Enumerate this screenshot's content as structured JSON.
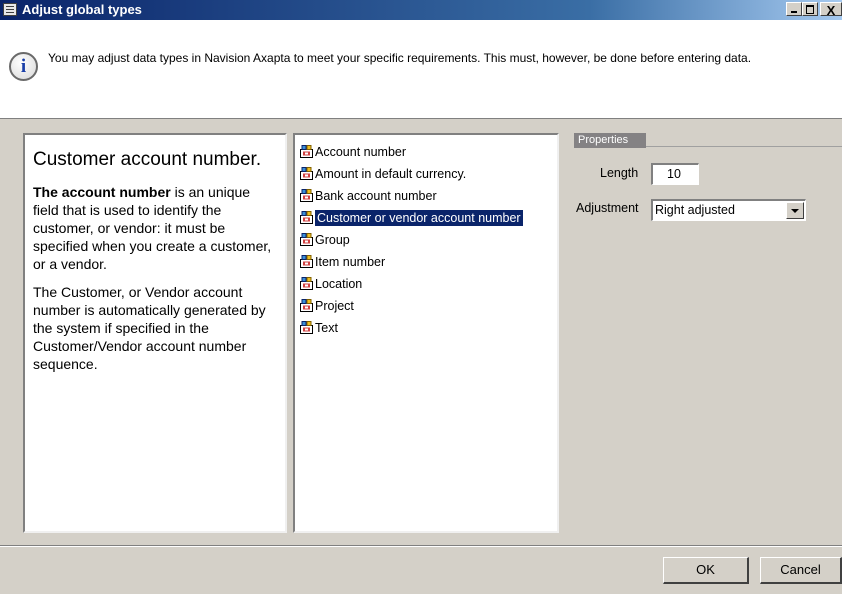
{
  "window": {
    "title": "Adjust global types",
    "close_glyph": "X"
  },
  "info": {
    "icon": "info-icon",
    "icon_glyph": "i",
    "text": "You may adjust data types in Navision Axapta to meet your specific requirements. This must, however, be done before entering data."
  },
  "help": {
    "title": "Customer account number.",
    "p1_bold": "The account number",
    "p1_rest": " is an unique field that is used to identify the customer, or vendor: it must be specified when you create a customer, or a vendor.",
    "p2": "The Customer, or Vendor account number is automatically generated by the system if specified in the Customer/Vendor account number sequence."
  },
  "types": {
    "items": [
      {
        "label": "Account number",
        "icon": "extended-datatype-icon"
      },
      {
        "label": "Amount in default currency.",
        "icon": "extended-datatype-icon"
      },
      {
        "label": "Bank account number",
        "icon": "extended-datatype-icon"
      },
      {
        "label": "Customer or vendor account number",
        "icon": "extended-datatype-icon",
        "selected": true
      },
      {
        "label": "Group",
        "icon": "extended-datatype-icon"
      },
      {
        "label": "Item number",
        "icon": "extended-datatype-icon"
      },
      {
        "label": "Location",
        "icon": "extended-datatype-icon"
      },
      {
        "label": "Project",
        "icon": "extended-datatype-icon"
      },
      {
        "label": "Text",
        "icon": "extended-datatype-icon"
      }
    ]
  },
  "properties": {
    "tab_label": "Properties",
    "length_label": "Length",
    "length_value": "10",
    "adjustment_label": "Adjustment",
    "adjustment_value": "Right adjusted"
  },
  "buttons": {
    "ok": "OK",
    "cancel": "Cancel"
  },
  "colors": {
    "title_bar": "#0a246a",
    "selection": "#0a246a",
    "dialog_face": "#d4d0c8"
  }
}
